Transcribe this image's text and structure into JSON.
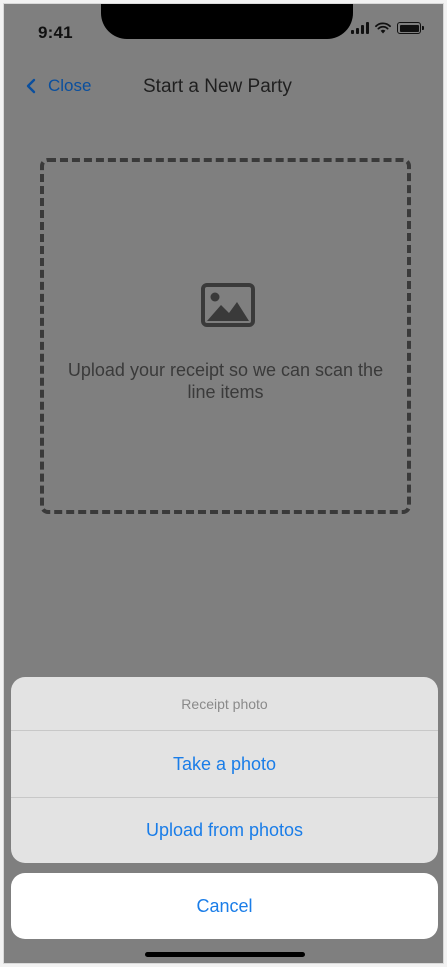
{
  "status_bar": {
    "time": "9:41",
    "icons": [
      "signal-icon",
      "wifi-icon",
      "battery-icon"
    ]
  },
  "nav": {
    "back_label": "Close",
    "title": "Start a New Party",
    "back_icon": "chevron-left-icon"
  },
  "upload": {
    "icon": "image-icon",
    "text": "Upload your receipt so we can scan the line items"
  },
  "action_sheet": {
    "title": "Receipt photo",
    "options": [
      "Take a photo",
      "Upload from photos"
    ],
    "cancel_label": "Cancel"
  },
  "colors": {
    "overlay": "#7f7f7f",
    "action_blue": "#1a7de8",
    "nav_blue": "#0a4f9e"
  }
}
